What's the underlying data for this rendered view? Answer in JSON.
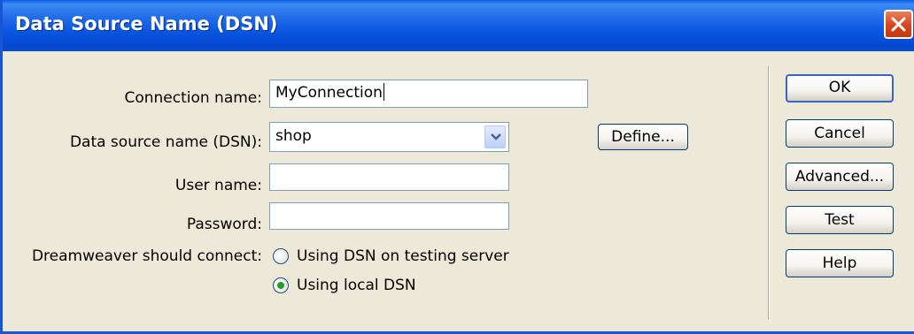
{
  "window": {
    "title": "Data Source Name (DSN)"
  },
  "form": {
    "connection_name_label": "Connection name:",
    "connection_name_value": "MyConnection",
    "dsn_label": "Data source name (DSN):",
    "dsn_value": "shop",
    "define_button": "Define...",
    "username_label": "User name:",
    "username_value": "",
    "password_label": "Password:",
    "password_value": "",
    "connect_label": "Dreamweaver should connect:",
    "radio_options": [
      {
        "label": "Using DSN on testing server",
        "selected": false
      },
      {
        "label": "Using local DSN",
        "selected": true
      }
    ]
  },
  "buttons": {
    "ok": "OK",
    "cancel": "Cancel",
    "advanced": "Advanced...",
    "test": "Test",
    "help": "Help"
  },
  "colors": {
    "titlebar": "#0a57e0",
    "dialog_bg": "#ece9d8",
    "radio_selected": "#21a121",
    "close_button": "#d6451f"
  },
  "icons": [
    "close-icon",
    "chevron-down-icon"
  ]
}
